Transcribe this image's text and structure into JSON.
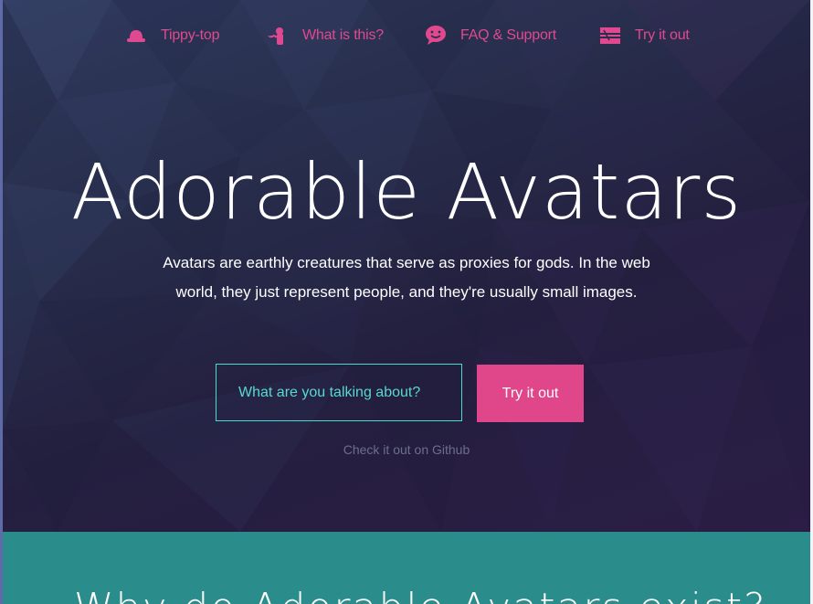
{
  "nav": {
    "items": [
      {
        "label": "Tippy-top",
        "icon": "top-hat-icon"
      },
      {
        "label": "What is this?",
        "icon": "mustache-head-icon"
      },
      {
        "label": "FAQ & Support",
        "icon": "speech-bubble-face-icon"
      },
      {
        "label": "Try it out",
        "icon": "tray-icon"
      }
    ]
  },
  "hero": {
    "title": "Adorable Avatars",
    "subtitle": "Avatars are earthly creatures that serve as proxies for gods. In the web world, they just represent people, and they're usually small images.",
    "search_placeholder": "What are you talking about?",
    "try_button": "Try it out",
    "github_link": "Check it out on Github"
  },
  "section": {
    "heading": "Why do Adorable Avatars exist?"
  },
  "colors": {
    "accent_pink": "#e0468a",
    "accent_teal": "#4fd8d0",
    "hero_bg": "#272c4a",
    "section_bg": "#2a8d8b"
  }
}
